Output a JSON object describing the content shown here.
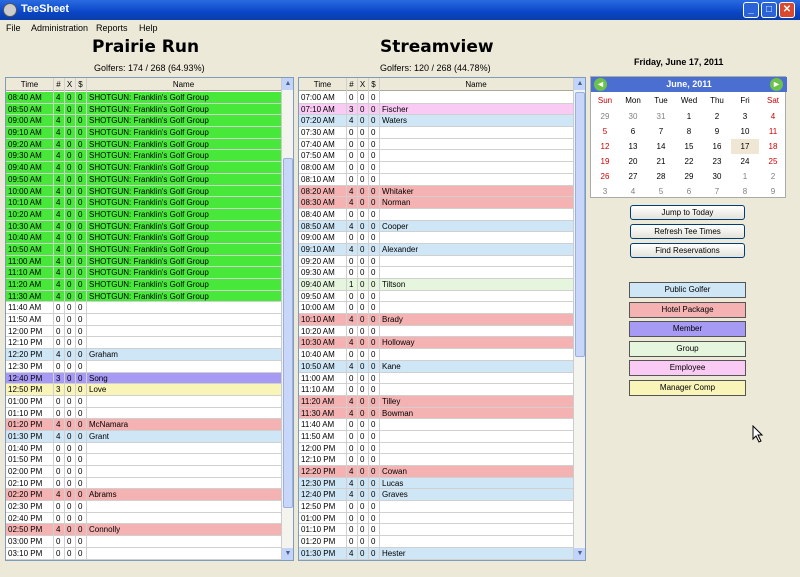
{
  "window": {
    "title": "TeeSheet",
    "min": "_",
    "max": "□",
    "close": "✕"
  },
  "menu": [
    "File",
    "Administration",
    "Reports",
    "Help"
  ],
  "courses": [
    {
      "name": "Prairie Run",
      "golfers": "Golfers: 174 / 268 (64.93%)",
      "rows": [
        {
          "time": "08:40 AM",
          "n": "4",
          "x": "0",
          "d": "0",
          "name": "SHOTGUN: Franklin's Golf Group",
          "cat": "group-green"
        },
        {
          "time": "08:50 AM",
          "n": "4",
          "x": "0",
          "d": "0",
          "name": "SHOTGUN: Franklin's Golf Group",
          "cat": "group-green"
        },
        {
          "time": "09:00 AM",
          "n": "4",
          "x": "0",
          "d": "0",
          "name": "SHOTGUN: Franklin's Golf Group",
          "cat": "group-green"
        },
        {
          "time": "09:10 AM",
          "n": "4",
          "x": "0",
          "d": "0",
          "name": "SHOTGUN: Franklin's Golf Group",
          "cat": "group-green"
        },
        {
          "time": "09:20 AM",
          "n": "4",
          "x": "0",
          "d": "0",
          "name": "SHOTGUN: Franklin's Golf Group",
          "cat": "group-green"
        },
        {
          "time": "09:30 AM",
          "n": "4",
          "x": "0",
          "d": "0",
          "name": "SHOTGUN: Franklin's Golf Group",
          "cat": "group-green"
        },
        {
          "time": "09:40 AM",
          "n": "4",
          "x": "0",
          "d": "0",
          "name": "SHOTGUN: Franklin's Golf Group",
          "cat": "group-green"
        },
        {
          "time": "09:50 AM",
          "n": "4",
          "x": "0",
          "d": "0",
          "name": "SHOTGUN: Franklin's Golf Group",
          "cat": "group-green"
        },
        {
          "time": "10:00 AM",
          "n": "4",
          "x": "0",
          "d": "0",
          "name": "SHOTGUN: Franklin's Golf Group",
          "cat": "group-green"
        },
        {
          "time": "10:10 AM",
          "n": "4",
          "x": "0",
          "d": "0",
          "name": "SHOTGUN: Franklin's Golf Group",
          "cat": "group-green"
        },
        {
          "time": "10:20 AM",
          "n": "4",
          "x": "0",
          "d": "0",
          "name": "SHOTGUN: Franklin's Golf Group",
          "cat": "group-green"
        },
        {
          "time": "10:30 AM",
          "n": "4",
          "x": "0",
          "d": "0",
          "name": "SHOTGUN: Franklin's Golf Group",
          "cat": "group-green"
        },
        {
          "time": "10:40 AM",
          "n": "4",
          "x": "0",
          "d": "0",
          "name": "SHOTGUN: Franklin's Golf Group",
          "cat": "group-green"
        },
        {
          "time": "10:50 AM",
          "n": "4",
          "x": "0",
          "d": "0",
          "name": "SHOTGUN: Franklin's Golf Group",
          "cat": "group-green"
        },
        {
          "time": "11:00 AM",
          "n": "4",
          "x": "0",
          "d": "0",
          "name": "SHOTGUN: Franklin's Golf Group",
          "cat": "group-green"
        },
        {
          "time": "11:10 AM",
          "n": "4",
          "x": "0",
          "d": "0",
          "name": "SHOTGUN: Franklin's Golf Group",
          "cat": "group-green"
        },
        {
          "time": "11:20 AM",
          "n": "4",
          "x": "0",
          "d": "0",
          "name": "SHOTGUN: Franklin's Golf Group",
          "cat": "group-green"
        },
        {
          "time": "11:30 AM",
          "n": "4",
          "x": "0",
          "d": "0",
          "name": "SHOTGUN: Franklin's Golf Group",
          "cat": "group-green"
        },
        {
          "time": "11:40 AM",
          "n": "0",
          "x": "0",
          "d": "0",
          "name": "",
          "cat": "empty"
        },
        {
          "time": "11:50 AM",
          "n": "0",
          "x": "0",
          "d": "0",
          "name": "",
          "cat": "empty"
        },
        {
          "time": "12:00 PM",
          "n": "0",
          "x": "0",
          "d": "0",
          "name": "",
          "cat": "empty"
        },
        {
          "time": "12:10 PM",
          "n": "0",
          "x": "0",
          "d": "0",
          "name": "",
          "cat": "empty"
        },
        {
          "time": "12:20 PM",
          "n": "4",
          "x": "0",
          "d": "0",
          "name": "Graham",
          "cat": "public"
        },
        {
          "time": "12:30 PM",
          "n": "0",
          "x": "0",
          "d": "0",
          "name": "",
          "cat": "empty"
        },
        {
          "time": "12:40 PM",
          "n": "3",
          "x": "0",
          "d": "0",
          "name": "Song",
          "cat": "member"
        },
        {
          "time": "12:50 PM",
          "n": "3",
          "x": "0",
          "d": "0",
          "name": "Love",
          "cat": "comp"
        },
        {
          "time": "01:00 PM",
          "n": "0",
          "x": "0",
          "d": "0",
          "name": "",
          "cat": "empty"
        },
        {
          "time": "01:10 PM",
          "n": "0",
          "x": "0",
          "d": "0",
          "name": "",
          "cat": "empty"
        },
        {
          "time": "01:20 PM",
          "n": "4",
          "x": "0",
          "d": "0",
          "name": "McNamara",
          "cat": "hotel"
        },
        {
          "time": "01:30 PM",
          "n": "4",
          "x": "0",
          "d": "0",
          "name": "Grant",
          "cat": "public"
        },
        {
          "time": "01:40 PM",
          "n": "0",
          "x": "0",
          "d": "0",
          "name": "",
          "cat": "empty"
        },
        {
          "time": "01:50 PM",
          "n": "0",
          "x": "0",
          "d": "0",
          "name": "",
          "cat": "empty"
        },
        {
          "time": "02:00 PM",
          "n": "0",
          "x": "0",
          "d": "0",
          "name": "",
          "cat": "empty"
        },
        {
          "time": "02:10 PM",
          "n": "0",
          "x": "0",
          "d": "0",
          "name": "",
          "cat": "empty"
        },
        {
          "time": "02:20 PM",
          "n": "4",
          "x": "0",
          "d": "0",
          "name": "Abrams",
          "cat": "hotel"
        },
        {
          "time": "02:30 PM",
          "n": "0",
          "x": "0",
          "d": "0",
          "name": "",
          "cat": "empty"
        },
        {
          "time": "02:40 PM",
          "n": "0",
          "x": "0",
          "d": "0",
          "name": "",
          "cat": "empty"
        },
        {
          "time": "02:50 PM",
          "n": "4",
          "x": "0",
          "d": "0",
          "name": "Connolly",
          "cat": "hotel"
        },
        {
          "time": "03:00 PM",
          "n": "0",
          "x": "0",
          "d": "0",
          "name": "",
          "cat": "empty"
        },
        {
          "time": "03:10 PM",
          "n": "0",
          "x": "0",
          "d": "0",
          "name": "",
          "cat": "empty"
        }
      ]
    },
    {
      "name": "Streamview",
      "golfers": "Golfers: 120 / 268 (44.78%)",
      "rows": [
        {
          "time": "07:00 AM",
          "n": "0",
          "x": "0",
          "d": "0",
          "name": "",
          "cat": "empty"
        },
        {
          "time": "07:10 AM",
          "n": "3",
          "x": "0",
          "d": "0",
          "name": "Fischer",
          "cat": "employee"
        },
        {
          "time": "07:20 AM",
          "n": "4",
          "x": "0",
          "d": "0",
          "name": "Waters",
          "cat": "public"
        },
        {
          "time": "07:30 AM",
          "n": "0",
          "x": "0",
          "d": "0",
          "name": "",
          "cat": "empty"
        },
        {
          "time": "07:40 AM",
          "n": "0",
          "x": "0",
          "d": "0",
          "name": "",
          "cat": "empty"
        },
        {
          "time": "07:50 AM",
          "n": "0",
          "x": "0",
          "d": "0",
          "name": "",
          "cat": "empty"
        },
        {
          "time": "08:00 AM",
          "n": "0",
          "x": "0",
          "d": "0",
          "name": "",
          "cat": "empty"
        },
        {
          "time": "08:10 AM",
          "n": "0",
          "x": "0",
          "d": "0",
          "name": "",
          "cat": "empty"
        },
        {
          "time": "08:20 AM",
          "n": "4",
          "x": "0",
          "d": "0",
          "name": "Whitaker",
          "cat": "hotel"
        },
        {
          "time": "08:30 AM",
          "n": "4",
          "x": "0",
          "d": "0",
          "name": "Norman",
          "cat": "hotel"
        },
        {
          "time": "08:40 AM",
          "n": "0",
          "x": "0",
          "d": "0",
          "name": "",
          "cat": "empty"
        },
        {
          "time": "08:50 AM",
          "n": "4",
          "x": "0",
          "d": "0",
          "name": "Cooper",
          "cat": "public"
        },
        {
          "time": "09:00 AM",
          "n": "0",
          "x": "0",
          "d": "0",
          "name": "",
          "cat": "empty"
        },
        {
          "time": "09:10 AM",
          "n": "4",
          "x": "0",
          "d": "0",
          "name": "Alexander",
          "cat": "public"
        },
        {
          "time": "09:20 AM",
          "n": "0",
          "x": "0",
          "d": "0",
          "name": "",
          "cat": "empty"
        },
        {
          "time": "09:30 AM",
          "n": "0",
          "x": "0",
          "d": "0",
          "name": "",
          "cat": "empty"
        },
        {
          "time": "09:40 AM",
          "n": "1",
          "x": "0",
          "d": "0",
          "name": "Tiltson",
          "cat": "grp"
        },
        {
          "time": "09:50 AM",
          "n": "0",
          "x": "0",
          "d": "0",
          "name": "",
          "cat": "empty"
        },
        {
          "time": "10:00 AM",
          "n": "0",
          "x": "0",
          "d": "0",
          "name": "",
          "cat": "empty"
        },
        {
          "time": "10:10 AM",
          "n": "4",
          "x": "0",
          "d": "0",
          "name": "Brady",
          "cat": "hotel"
        },
        {
          "time": "10:20 AM",
          "n": "0",
          "x": "0",
          "d": "0",
          "name": "",
          "cat": "empty"
        },
        {
          "time": "10:30 AM",
          "n": "4",
          "x": "0",
          "d": "0",
          "name": "Holloway",
          "cat": "hotel"
        },
        {
          "time": "10:40 AM",
          "n": "0",
          "x": "0",
          "d": "0",
          "name": "",
          "cat": "empty"
        },
        {
          "time": "10:50 AM",
          "n": "4",
          "x": "0",
          "d": "0",
          "name": "Kane",
          "cat": "public"
        },
        {
          "time": "11:00 AM",
          "n": "0",
          "x": "0",
          "d": "0",
          "name": "",
          "cat": "empty"
        },
        {
          "time": "11:10 AM",
          "n": "0",
          "x": "0",
          "d": "0",
          "name": "",
          "cat": "empty"
        },
        {
          "time": "11:20 AM",
          "n": "4",
          "x": "0",
          "d": "0",
          "name": "Tilley",
          "cat": "hotel"
        },
        {
          "time": "11:30 AM",
          "n": "4",
          "x": "0",
          "d": "0",
          "name": "Bowman",
          "cat": "hotel"
        },
        {
          "time": "11:40 AM",
          "n": "0",
          "x": "0",
          "d": "0",
          "name": "",
          "cat": "empty"
        },
        {
          "time": "11:50 AM",
          "n": "0",
          "x": "0",
          "d": "0",
          "name": "",
          "cat": "empty"
        },
        {
          "time": "12:00 PM",
          "n": "0",
          "x": "0",
          "d": "0",
          "name": "",
          "cat": "empty"
        },
        {
          "time": "12:10 PM",
          "n": "0",
          "x": "0",
          "d": "0",
          "name": "",
          "cat": "empty"
        },
        {
          "time": "12:20 PM",
          "n": "4",
          "x": "0",
          "d": "0",
          "name": "Cowan",
          "cat": "hotel"
        },
        {
          "time": "12:30 PM",
          "n": "4",
          "x": "0",
          "d": "0",
          "name": "Lucas",
          "cat": "public"
        },
        {
          "time": "12:40 PM",
          "n": "4",
          "x": "0",
          "d": "0",
          "name": "Graves",
          "cat": "public"
        },
        {
          "time": "12:50 PM",
          "n": "0",
          "x": "0",
          "d": "0",
          "name": "",
          "cat": "empty"
        },
        {
          "time": "01:00 PM",
          "n": "0",
          "x": "0",
          "d": "0",
          "name": "",
          "cat": "empty"
        },
        {
          "time": "01:10 PM",
          "n": "0",
          "x": "0",
          "d": "0",
          "name": "",
          "cat": "empty"
        },
        {
          "time": "01:20 PM",
          "n": "0",
          "x": "0",
          "d": "0",
          "name": "",
          "cat": "empty"
        },
        {
          "time": "01:30 PM",
          "n": "4",
          "x": "0",
          "d": "0",
          "name": "Hester",
          "cat": "public"
        }
      ]
    }
  ],
  "grid_headers": {
    "time": "Time",
    "n": "#",
    "x": "X",
    "d": "$",
    "name": "Name"
  },
  "date_label": "Friday, June 17, 2011",
  "calendar": {
    "month_label": "June, 2011",
    "prev_icon": "◄",
    "next_icon": "►",
    "day_names": [
      "Sun",
      "Mon",
      "Tue",
      "Wed",
      "Thu",
      "Fri",
      "Sat"
    ],
    "weeks": [
      [
        "29",
        "30",
        "31",
        "1",
        "2",
        "3",
        "4"
      ],
      [
        "5",
        "6",
        "7",
        "8",
        "9",
        "10",
        "11"
      ],
      [
        "12",
        "13",
        "14",
        "15",
        "16",
        "17",
        "18"
      ],
      [
        "19",
        "20",
        "21",
        "22",
        "23",
        "24",
        "25"
      ],
      [
        "26",
        "27",
        "28",
        "29",
        "30",
        "1",
        "2"
      ],
      [
        "3",
        "4",
        "5",
        "6",
        "7",
        "8",
        "9"
      ]
    ],
    "selected_day": "17"
  },
  "buttons": [
    "Jump to Today",
    "Refresh Tee Times",
    "Find Reservations"
  ],
  "legend": [
    {
      "label": "Public Golfer",
      "cat": "public"
    },
    {
      "label": "Hotel Package",
      "cat": "hotel"
    },
    {
      "label": "Member",
      "cat": "member"
    },
    {
      "label": "Group",
      "cat": "grp"
    },
    {
      "label": "Employee",
      "cat": "employee"
    },
    {
      "label": "Manager Comp",
      "cat": "comp"
    }
  ],
  "colors": {
    "group-green": "#47e83a",
    "empty": "#ffffff",
    "public": "#cfe6f6",
    "hotel": "#f4b2b2",
    "member": "#a79af5",
    "grp": "#e5f5de",
    "employee": "#f9caf3",
    "comp": "#f9f5b8",
    "weekend": "#cc0000",
    "muted": "#808080"
  }
}
